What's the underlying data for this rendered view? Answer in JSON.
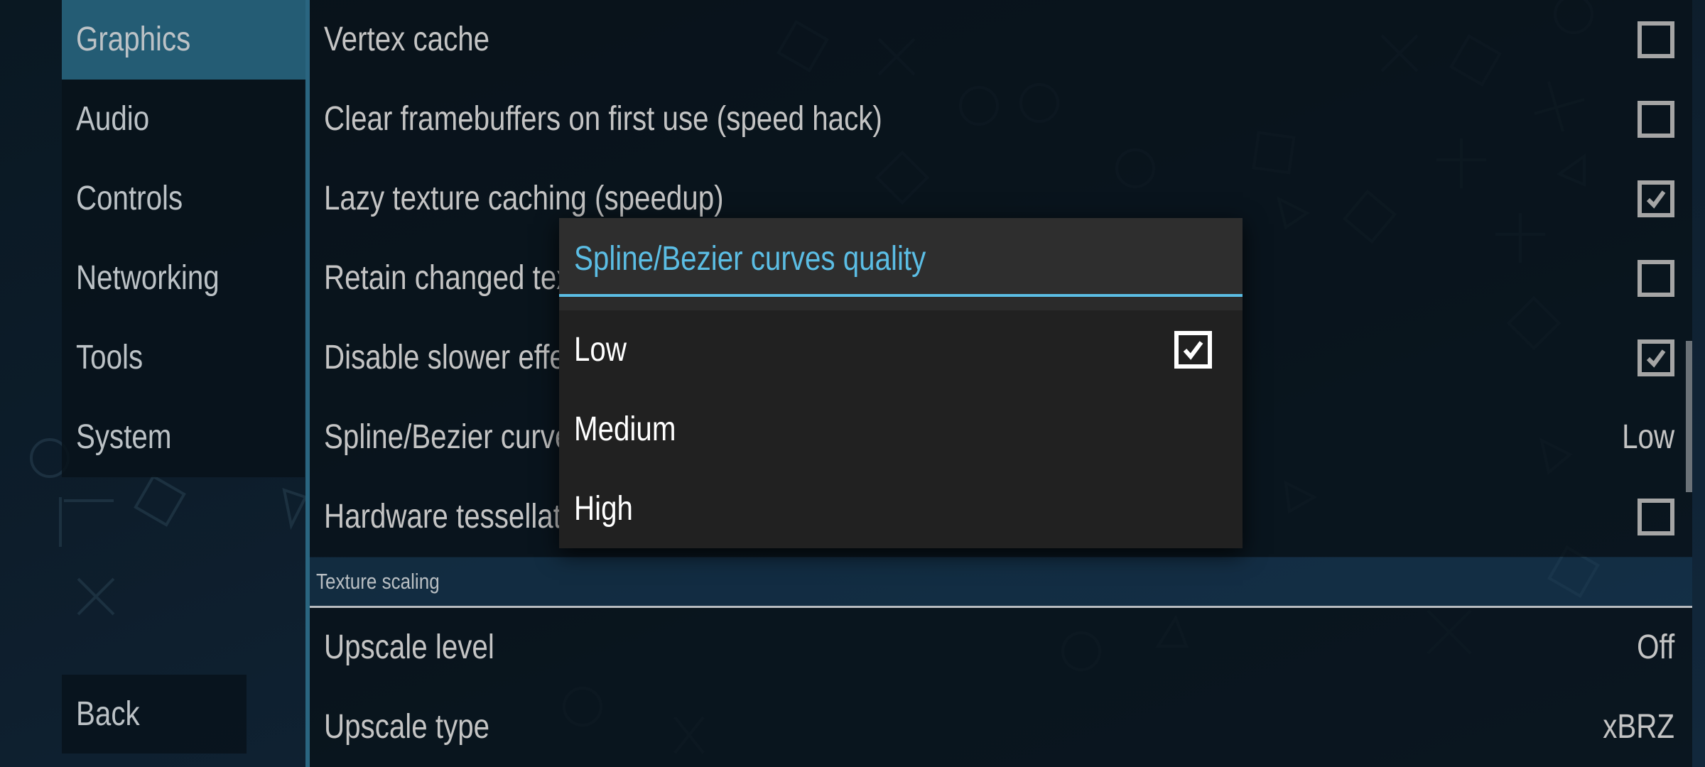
{
  "sidebar": {
    "items": [
      {
        "label": "Graphics",
        "active": true
      },
      {
        "label": "Audio",
        "active": false
      },
      {
        "label": "Controls",
        "active": false
      },
      {
        "label": "Networking",
        "active": false
      },
      {
        "label": "Tools",
        "active": false
      },
      {
        "label": "System",
        "active": false
      }
    ],
    "back_label": "Back"
  },
  "settings": {
    "rows": [
      {
        "label": "Vertex cache",
        "type": "checkbox",
        "checked": false
      },
      {
        "label": "Clear framebuffers on first use (speed hack)",
        "type": "checkbox",
        "checked": false
      },
      {
        "label": "Lazy texture caching (speedup)",
        "type": "checkbox",
        "checked": true
      },
      {
        "label": "Retain changed textures (sometimes slower)",
        "type": "checkbox",
        "checked": false
      },
      {
        "label": "Disable slower effects (speedup)",
        "type": "checkbox",
        "checked": true
      },
      {
        "label": "Spline/Bezier curves quality",
        "type": "choice",
        "value": "Low"
      },
      {
        "label": "Hardware tessellation",
        "type": "checkbox",
        "checked": false
      }
    ],
    "section": {
      "title": "Texture scaling",
      "rows": [
        {
          "label": "Upscale level",
          "type": "choice",
          "value": "Off"
        },
        {
          "label": "Upscale type",
          "type": "choice",
          "value": "xBRZ"
        }
      ]
    }
  },
  "dialog": {
    "title": "Spline/Bezier curves quality",
    "options": [
      {
        "label": "Low",
        "selected": true
      },
      {
        "label": "Medium",
        "selected": false
      },
      {
        "label": "High",
        "selected": false
      }
    ]
  },
  "colors": {
    "accent": "#5bbde4",
    "active_tab": "#245c74",
    "divider": "#2a6580",
    "dialog_bg": "#212121"
  }
}
